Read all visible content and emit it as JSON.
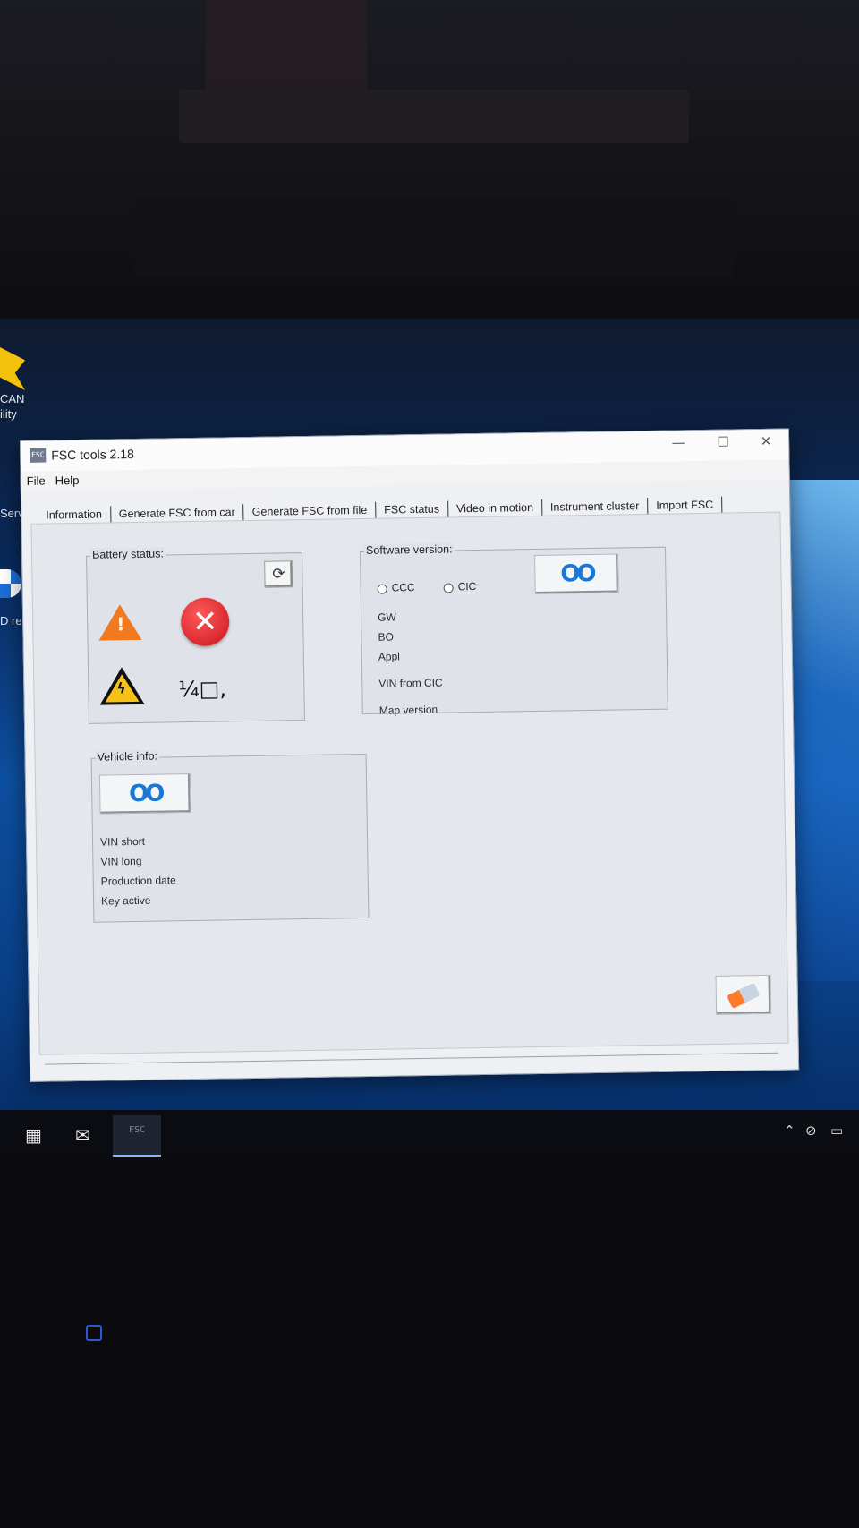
{
  "desktop": {
    "left_text_1": "CAN",
    "left_text_2": "ility",
    "left_text_3": "Serv",
    "left_text_4": "D re"
  },
  "window": {
    "logo_text": "FSC",
    "title": "FSC tools 2.18",
    "minimize": "—",
    "maximize": "☐",
    "close": "✕"
  },
  "menu": {
    "file": "File",
    "help": "Help"
  },
  "tabs": [
    "Information",
    "Generate FSC from car",
    "Generate FSC from file",
    "FSC status",
    "Video in motion",
    "Instrument cluster",
    "Import FSC"
  ],
  "battery": {
    "legend": "Battery status:",
    "garbled_text": "¼□,"
  },
  "software": {
    "legend": "Software version:",
    "radio_ccc": "CCC",
    "radio_cic": "CIC",
    "labels": [
      "GW",
      "BO",
      "Appl",
      "VIN from CIC",
      "Map version"
    ]
  },
  "vehicle": {
    "legend": "Vehicle info:",
    "labels": [
      "VIN short",
      "VIN long",
      "Production date",
      "Key active"
    ]
  },
  "icons": {
    "read": "glasses-icon",
    "refresh": "refresh-icon",
    "eraser": "eraser-icon"
  },
  "colors": {
    "accent_blue": "#1a78d2",
    "error_red": "#c8141c",
    "warning_orange": "#f07a22"
  },
  "taskbar": {
    "app_label": "FSC"
  }
}
